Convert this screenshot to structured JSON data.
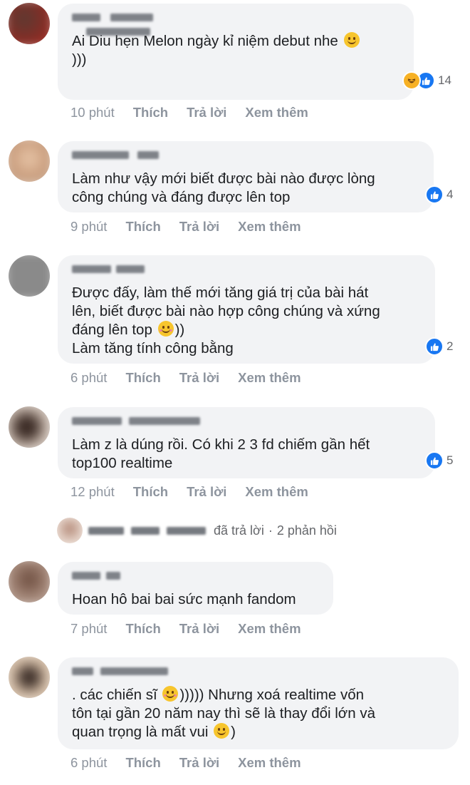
{
  "actions": {
    "like": "Thích",
    "reply": "Trả lời",
    "see_more": "Xem thêm"
  },
  "comments": [
    {
      "text": "Ai Diu hẹn Melon ngày kỉ niệm debut nhe",
      "text_after_emoji": "\n)))",
      "emoji": "smile-emoji",
      "time": "10 phút",
      "reactions": {
        "icons": [
          "haha-icon",
          "like-icon"
        ],
        "count": "14"
      }
    },
    {
      "text": "Làm như vậy mới biết được bài nào được lòng\ncông chúng và đáng được lên top",
      "time": "9 phút",
      "reactions": {
        "icons": [
          "like-icon"
        ],
        "count": "4"
      }
    },
    {
      "text": "Được đấy, làm thế mới tăng giá trị của bài hát\nlên, biết được bài nào hợp công chúng và xứng\nđáng lên top",
      "text_after_emoji": "))\nLàm tăng tính công bằng",
      "emoji": "blush-emoji",
      "time": "6 phút",
      "reactions": {
        "icons": [
          "like-icon"
        ],
        "count": "2"
      }
    },
    {
      "text": "Làm z là dúng rồi. Có khi 2 3 fd chiếm gần hết\ntop100 realtime",
      "time": "12 phút",
      "reactions": {
        "icons": [
          "like-icon"
        ],
        "count": "5"
      }
    },
    {
      "reply_summary": {
        "replied": "đã trả lời",
        "separator": "·",
        "count": "2 phản hồi"
      }
    },
    {
      "text": "Hoan hô bai bai sức mạnh fandom",
      "time": "7 phút"
    },
    {
      "text": ". các chiến sĩ",
      "text_after_emoji": "))))) Nhưng xoá realtime vốn\ntôn tại gần 20 năm nay thì sẽ là thay đổi lớn và\nquan trọng là mất vui",
      "text_after_emoji2": ")",
      "emoji": "blush-emoji",
      "emoji2": "smile-emoji",
      "time": "6 phút"
    }
  ],
  "colors": {
    "bubble": "#f2f3f5",
    "like_blue": "#1877f2",
    "haha_yellow": "#f7b125",
    "meta_gray": "#8d949e"
  }
}
